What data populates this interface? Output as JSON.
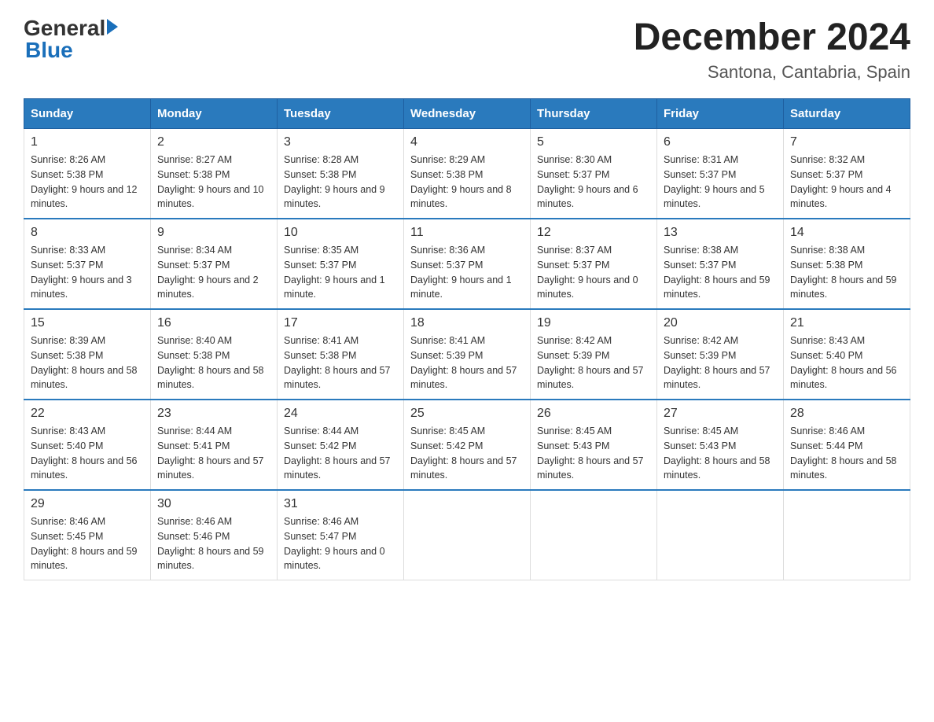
{
  "header": {
    "logo": {
      "general": "General",
      "blue": "Blue"
    },
    "title": "December 2024",
    "subtitle": "Santona, Cantabria, Spain"
  },
  "calendar": {
    "days_of_week": [
      "Sunday",
      "Monday",
      "Tuesday",
      "Wednesday",
      "Thursday",
      "Friday",
      "Saturday"
    ],
    "weeks": [
      [
        {
          "day": "1",
          "sunrise": "8:26 AM",
          "sunset": "5:38 PM",
          "daylight": "9 hours and 12 minutes."
        },
        {
          "day": "2",
          "sunrise": "8:27 AM",
          "sunset": "5:38 PM",
          "daylight": "9 hours and 10 minutes."
        },
        {
          "day": "3",
          "sunrise": "8:28 AM",
          "sunset": "5:38 PM",
          "daylight": "9 hours and 9 minutes."
        },
        {
          "day": "4",
          "sunrise": "8:29 AM",
          "sunset": "5:38 PM",
          "daylight": "9 hours and 8 minutes."
        },
        {
          "day": "5",
          "sunrise": "8:30 AM",
          "sunset": "5:37 PM",
          "daylight": "9 hours and 6 minutes."
        },
        {
          "day": "6",
          "sunrise": "8:31 AM",
          "sunset": "5:37 PM",
          "daylight": "9 hours and 5 minutes."
        },
        {
          "day": "7",
          "sunrise": "8:32 AM",
          "sunset": "5:37 PM",
          "daylight": "9 hours and 4 minutes."
        }
      ],
      [
        {
          "day": "8",
          "sunrise": "8:33 AM",
          "sunset": "5:37 PM",
          "daylight": "9 hours and 3 minutes."
        },
        {
          "day": "9",
          "sunrise": "8:34 AM",
          "sunset": "5:37 PM",
          "daylight": "9 hours and 2 minutes."
        },
        {
          "day": "10",
          "sunrise": "8:35 AM",
          "sunset": "5:37 PM",
          "daylight": "9 hours and 1 minute."
        },
        {
          "day": "11",
          "sunrise": "8:36 AM",
          "sunset": "5:37 PM",
          "daylight": "9 hours and 1 minute."
        },
        {
          "day": "12",
          "sunrise": "8:37 AM",
          "sunset": "5:37 PM",
          "daylight": "9 hours and 0 minutes."
        },
        {
          "day": "13",
          "sunrise": "8:38 AM",
          "sunset": "5:37 PM",
          "daylight": "8 hours and 59 minutes."
        },
        {
          "day": "14",
          "sunrise": "8:38 AM",
          "sunset": "5:38 PM",
          "daylight": "8 hours and 59 minutes."
        }
      ],
      [
        {
          "day": "15",
          "sunrise": "8:39 AM",
          "sunset": "5:38 PM",
          "daylight": "8 hours and 58 minutes."
        },
        {
          "day": "16",
          "sunrise": "8:40 AM",
          "sunset": "5:38 PM",
          "daylight": "8 hours and 58 minutes."
        },
        {
          "day": "17",
          "sunrise": "8:41 AM",
          "sunset": "5:38 PM",
          "daylight": "8 hours and 57 minutes."
        },
        {
          "day": "18",
          "sunrise": "8:41 AM",
          "sunset": "5:39 PM",
          "daylight": "8 hours and 57 minutes."
        },
        {
          "day": "19",
          "sunrise": "8:42 AM",
          "sunset": "5:39 PM",
          "daylight": "8 hours and 57 minutes."
        },
        {
          "day": "20",
          "sunrise": "8:42 AM",
          "sunset": "5:39 PM",
          "daylight": "8 hours and 57 minutes."
        },
        {
          "day": "21",
          "sunrise": "8:43 AM",
          "sunset": "5:40 PM",
          "daylight": "8 hours and 56 minutes."
        }
      ],
      [
        {
          "day": "22",
          "sunrise": "8:43 AM",
          "sunset": "5:40 PM",
          "daylight": "8 hours and 56 minutes."
        },
        {
          "day": "23",
          "sunrise": "8:44 AM",
          "sunset": "5:41 PM",
          "daylight": "8 hours and 57 minutes."
        },
        {
          "day": "24",
          "sunrise": "8:44 AM",
          "sunset": "5:42 PM",
          "daylight": "8 hours and 57 minutes."
        },
        {
          "day": "25",
          "sunrise": "8:45 AM",
          "sunset": "5:42 PM",
          "daylight": "8 hours and 57 minutes."
        },
        {
          "day": "26",
          "sunrise": "8:45 AM",
          "sunset": "5:43 PM",
          "daylight": "8 hours and 57 minutes."
        },
        {
          "day": "27",
          "sunrise": "8:45 AM",
          "sunset": "5:43 PM",
          "daylight": "8 hours and 58 minutes."
        },
        {
          "day": "28",
          "sunrise": "8:46 AM",
          "sunset": "5:44 PM",
          "daylight": "8 hours and 58 minutes."
        }
      ],
      [
        {
          "day": "29",
          "sunrise": "8:46 AM",
          "sunset": "5:45 PM",
          "daylight": "8 hours and 59 minutes."
        },
        {
          "day": "30",
          "sunrise": "8:46 AM",
          "sunset": "5:46 PM",
          "daylight": "8 hours and 59 minutes."
        },
        {
          "day": "31",
          "sunrise": "8:46 AM",
          "sunset": "5:47 PM",
          "daylight": "9 hours and 0 minutes."
        },
        null,
        null,
        null,
        null
      ]
    ],
    "sunrise_label": "Sunrise:",
    "sunset_label": "Sunset:",
    "daylight_label": "Daylight:"
  }
}
